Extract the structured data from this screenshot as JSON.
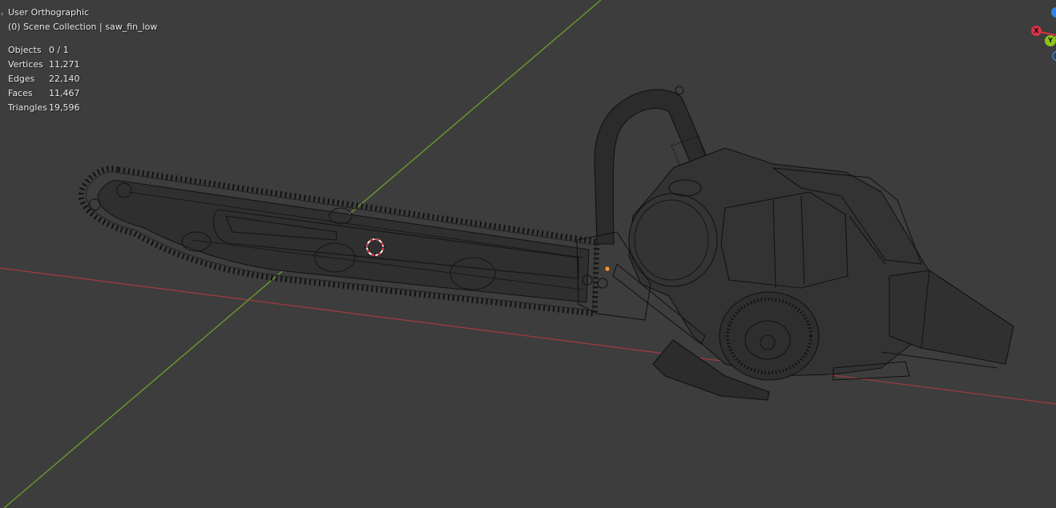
{
  "viewport": {
    "view_name": "User Orthographic",
    "collection_line": "(0) Scene Collection | saw_fin_low",
    "toolbar_toggle_icon": "chevron-right-icon"
  },
  "stats": [
    {
      "label": "Objects",
      "value": "0 / 1"
    },
    {
      "label": "Vertices",
      "value": "11,271"
    },
    {
      "label": "Edges",
      "value": "22,140"
    },
    {
      "label": "Faces",
      "value": "11,467"
    },
    {
      "label": "Triangles",
      "value": "19,596"
    }
  ],
  "gizmo": {
    "x_label": "X",
    "y_label": "Y",
    "x_color": "#d8324a",
    "y_color": "#8cc31c",
    "z_color": "#2f84e3"
  },
  "colors": {
    "background": "#3d3d3d",
    "x_axis_line": "#a53a3f",
    "y_axis_line": "#6a9a2b",
    "wire": "#111111",
    "cursor_red": "#d8303a",
    "origin": "#ff9a1f"
  }
}
